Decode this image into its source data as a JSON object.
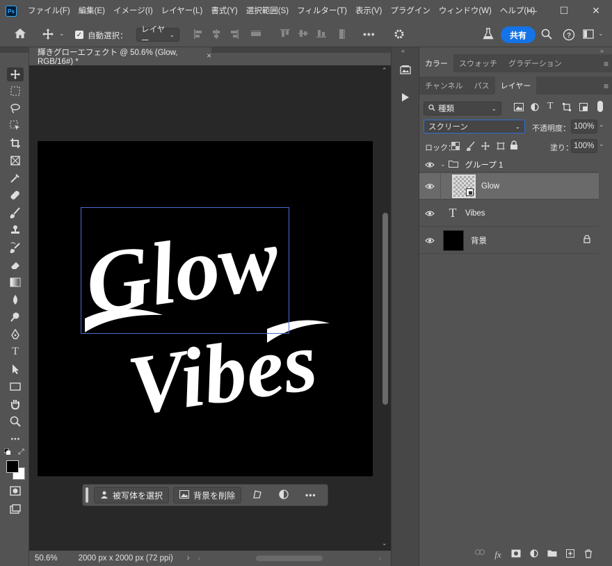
{
  "app": {
    "logo": "Ps"
  },
  "menu": [
    "ファイル(F)",
    "編集(E)",
    "イメージ(I)",
    "レイヤー(L)",
    "書式(Y)",
    "選択範囲(S)",
    "フィルター(T)",
    "表示(V)",
    "プラグイン",
    "ウィンドウ(W)",
    "ヘルプ(H)"
  ],
  "window_controls": {
    "minimize": "—",
    "maximize": "☐",
    "close": "✕"
  },
  "options": {
    "auto_select_label": "自動選択：",
    "auto_select_value": "レイヤー",
    "more": "•••",
    "share": "共有"
  },
  "document": {
    "tab_title": "輝きグローエフェクト @ 50.6% (Glow, RGB/16#) *",
    "close": "×",
    "text_line1": "Glow",
    "text_line2": "Vibes"
  },
  "context_bar": {
    "select_subject": "被写体を選択",
    "remove_bg": "背景を削除",
    "more": "•••"
  },
  "status": {
    "zoom": "50.6%",
    "doc_info": "2000 px x 2000 px (72 ppi)",
    "arrow": "›"
  },
  "panels": {
    "top_tabs": [
      "カラー",
      "スウォッチ",
      "グラデーション"
    ],
    "mid_tabs": [
      "チャンネル",
      "パス",
      "レイヤー"
    ],
    "filter_label": "種類",
    "blend_mode": "スクリーン",
    "opacity_label": "不透明度：",
    "opacity_value": "100%",
    "lock_label": "ロック：",
    "fill_label": "塗り：",
    "fill_value": "100%"
  },
  "layers": [
    {
      "name": "グループ 1",
      "type": "group"
    },
    {
      "name": "Glow",
      "type": "smart",
      "selected": true
    },
    {
      "name": "Vibes",
      "type": "text"
    },
    {
      "name": "背景",
      "type": "background",
      "locked": true
    }
  ],
  "colors": {
    "accent": "#1473e6",
    "selection_box": "#4a6cd4"
  }
}
